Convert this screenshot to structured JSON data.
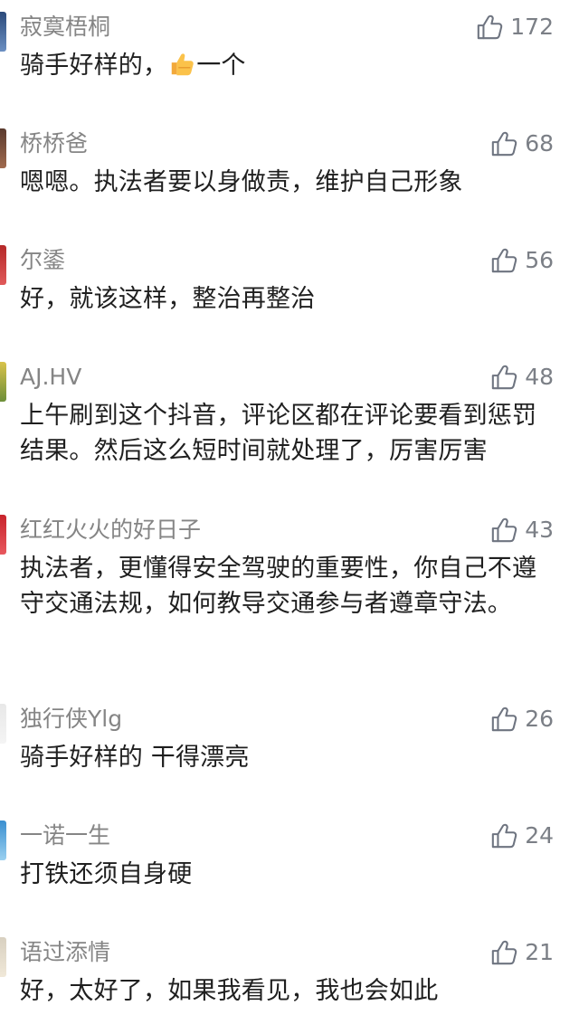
{
  "colors": {
    "username": "#858585",
    "text": "#1f1f1f",
    "like": "#7b7f86",
    "background": "#ffffff"
  },
  "comments": [
    {
      "username": "寂寞梧桐",
      "likes": "172",
      "text_before": "骑手好样的，",
      "emoji": "thumbs-up-emoji",
      "text_after": "一个",
      "avatar_colors": [
        "#2b4a7a",
        "#6b8fc2"
      ]
    },
    {
      "username": "桥桥爸",
      "likes": "68",
      "text": "嗯嗯。执法者要以身做责，维护自己形象",
      "avatar_colors": [
        "#5a3a2e",
        "#a06a4e"
      ]
    },
    {
      "username": "尔鋈",
      "likes": "56",
      "text": "好，就该这样，整治再整治",
      "avatar_colors": [
        "#b52828",
        "#e05a5a"
      ]
    },
    {
      "username": "AJ.HV",
      "likes": "48",
      "text": "上午刷到这个抖音，评论区都在评论要看到惩罚结果。然后这么短时间就处理了，厉害厉害",
      "avatar_colors": [
        "#d8c24a",
        "#6d8f3a"
      ]
    },
    {
      "username": "红红火火的好日子",
      "likes": "43",
      "text": "执法者，更懂得安全驾驶的重要性，你自己不遵守交通法规，如何教导交通参与者遵章守法。",
      "avatar_colors": [
        "#c8232b",
        "#e8585e"
      ]
    },
    {
      "username": "独行侠Ylg",
      "likes": "26",
      "text": "骑手好样的 干得漂亮",
      "avatar_colors": [
        "#e8e8e8",
        "#f4f4f4"
      ]
    },
    {
      "username": "一诺一生",
      "likes": "24",
      "text": "打铁还须自身硬",
      "avatar_colors": [
        "#3a8fd0",
        "#9ad0f0"
      ]
    },
    {
      "username": "语过添情",
      "likes": "21",
      "text": "好，太好了，如果我看见，我也会如此",
      "avatar_colors": [
        "#d8d0c0",
        "#f0e8d8"
      ]
    }
  ]
}
